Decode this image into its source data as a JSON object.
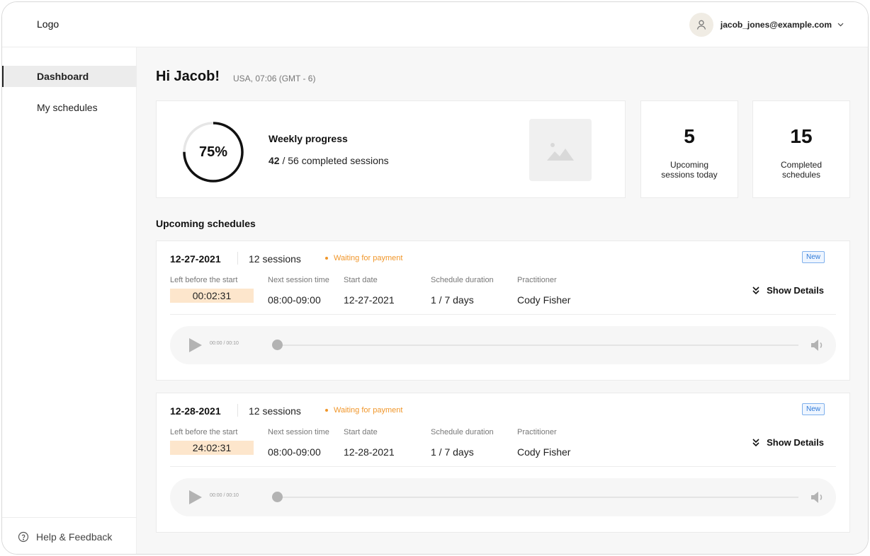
{
  "header": {
    "logo": "Logo",
    "user_email": "jacob_jones@example.com",
    "avatar_icon": "user-icon",
    "dropdown_icon": "chevron-down-icon"
  },
  "sidebar": {
    "items": [
      {
        "label": "Dashboard",
        "active": true
      },
      {
        "label": "My schedules",
        "active": false
      }
    ],
    "help": {
      "label": "Help & Feedback",
      "icon": "help-circle-icon"
    }
  },
  "main": {
    "greeting": "Hi Jacob!",
    "timezone": "USA, 07:06 (GMT - 6)",
    "progress": {
      "percent_label": "75%",
      "percent_value": 0.75,
      "title": "Weekly progress",
      "completed": "42",
      "total_text": "/ 56 completed sessions",
      "image_icon": "image-placeholder-icon"
    },
    "stats": [
      {
        "value": "5",
        "label": "Upcoming sessions today"
      },
      {
        "value": "15",
        "label": "Completed schedules"
      }
    ],
    "section_title": "Upcoming schedules",
    "schedules": [
      {
        "date": "12-27-2021",
        "sessions": "12 sessions",
        "status": "Waiting for payment",
        "badge": "New",
        "left_label": "Left before the start",
        "left_value": "00:02:31",
        "next_label": "Next session time",
        "next_value": "08:00-09:00",
        "start_label": "Start date",
        "start_value": "12-27-2021",
        "duration_label": "Schedule duration",
        "duration_value": "1 / 7 days",
        "practitioner_label": "Practitioner",
        "practitioner_value": "Cody Fisher",
        "show_details": "Show Details",
        "player_time": "00:00 / 00:10",
        "player_progress": 0
      },
      {
        "date": "12-28-2021",
        "sessions": "12 sessions",
        "status": "Waiting for payment",
        "badge": "New",
        "left_label": "Left before the start",
        "left_value": "24:02:31",
        "next_label": "Next session time",
        "next_value": "08:00-09:00",
        "start_label": "Start date",
        "start_value": "12-28-2021",
        "duration_label": "Schedule duration",
        "duration_value": "1 / 7 days",
        "practitioner_label": "Practitioner",
        "practitioner_value": "Cody Fisher",
        "show_details": "Show Details",
        "player_time": "00:00 / 00:10",
        "player_progress": 0
      }
    ]
  },
  "colors": {
    "status_orange": "#f0962a",
    "countdown_bg": "#fde6cc",
    "badge_blue": "#2f7ad8",
    "progress_ring": "#111111"
  }
}
